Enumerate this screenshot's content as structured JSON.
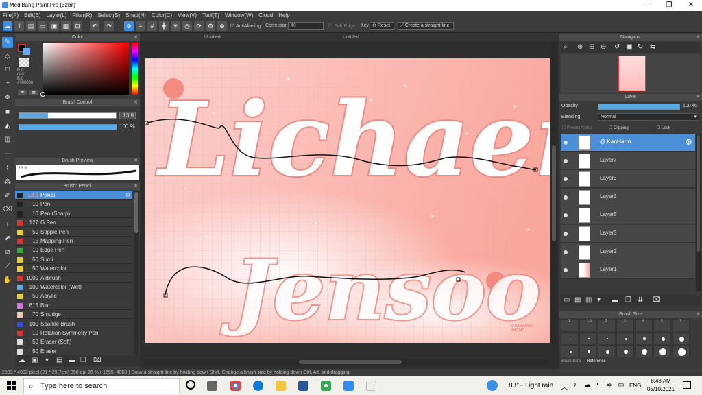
{
  "window": {
    "title": "MediBang Paint Pro (32bit)",
    "minimize": "—",
    "maximize": "❐",
    "close": "✕"
  },
  "menu": [
    "File(F)",
    "Edit(E)",
    "Layer(L)",
    "Filter(R)",
    "Select(S)",
    "Snap(N)",
    "Color(C)",
    "View(V)",
    "Tool(T)",
    "Window(W)",
    "Cloud",
    "Help"
  ],
  "toolbar": {
    "antialiasing": "AntiAliasing",
    "correction_label": "Correction",
    "correction_value": "40",
    "soft_edge": "Soft Edge",
    "key": "Key",
    "reset": "Reset",
    "straight_line": "Create a straight line"
  },
  "color_panel": {
    "title": "Color",
    "rgb": "R:0\nG:0\nB:0",
    "hex": "#000000",
    "primary": "#000000"
  },
  "brush_control": {
    "title": "Brush Control",
    "size": "13.9",
    "opacity": "100 %",
    "size_fraction": 0.3,
    "opacity_fraction": 1.0
  },
  "brush_preview": {
    "title": "Brush Preview",
    "size_label": "13.9"
  },
  "brush_list": {
    "title": "Brush: Pencil",
    "items": [
      {
        "size": "13.9",
        "name": "Pencil",
        "color": "#222222",
        "selected": true
      },
      {
        "size": "10",
        "name": "Pen",
        "color": "#222222"
      },
      {
        "size": "10",
        "name": "Pen (Sharp)",
        "color": "#222222"
      },
      {
        "size": "127",
        "name": "G Pen",
        "color": "#e03030"
      },
      {
        "size": "50",
        "name": "Stipple Pen",
        "color": "#e8d020"
      },
      {
        "size": "15",
        "name": "Mapping Pen",
        "color": "#e03030"
      },
      {
        "size": "10",
        "name": "Edge Pen",
        "color": "#30b030"
      },
      {
        "size": "50",
        "name": "Sumi",
        "color": "#e8d020"
      },
      {
        "size": "50",
        "name": "Watercolor",
        "color": "#e8d020"
      },
      {
        "size": "1000",
        "name": "Airbrush",
        "color": "#e03030"
      },
      {
        "size": "100",
        "name": "Watercolor (Wet)",
        "color": "#5aaae8"
      },
      {
        "size": "50",
        "name": "Acrylic",
        "color": "#e8d020"
      },
      {
        "size": "615",
        "name": "Blur",
        "color": "#e070e0"
      },
      {
        "size": "70",
        "name": "Smudge",
        "color": "#f0c8b0"
      },
      {
        "size": "100",
        "name": "Sparkle Brush",
        "color": "#3050e0"
      },
      {
        "size": "10",
        "name": "Rotation Symmetry Pen",
        "color": "#e03030"
      },
      {
        "size": "50",
        "name": "Eraser (Soft)",
        "color": "#dddddd"
      },
      {
        "size": "50",
        "name": "Eraser",
        "color": "#dddddd"
      }
    ]
  },
  "documents": {
    "tab1": "Untitled",
    "tab2": "Untitled"
  },
  "artwork": {
    "signature": "© KANHARIN\n#HD247"
  },
  "navigator": {
    "title": "Navigator"
  },
  "layer_panel": {
    "title": "Layer",
    "opacity_label": "Opacity",
    "opacity_value": "100 %",
    "opacity_fraction": 1.0,
    "blending_label": "Blending",
    "blending_value": "Normal",
    "protect_alpha": "Protect Alpha",
    "clipping": "Clipping",
    "lock": "Lock",
    "layers": [
      {
        "name": "@ KanHarin",
        "selected": true
      },
      {
        "name": "Layer7"
      },
      {
        "name": "Layer3"
      },
      {
        "name": "Layer3"
      },
      {
        "name": "Layer5"
      },
      {
        "name": "Layer5"
      },
      {
        "name": "Layer2"
      },
      {
        "name": "Layer1"
      }
    ]
  },
  "brush_size_panel": {
    "title": "Brush Size",
    "tabs": [
      "Brush Size",
      "Reference"
    ],
    "sizes": [
      "1",
      "1.5",
      "2",
      "3",
      "4",
      "5",
      "7"
    ]
  },
  "statusbar": "2893 * 4092 pixel  (21 * 29.7cm)  350 dpi  26 %  ( 1655, 4068 )  Draw a straight line by holding down Shift, Change a brush size by holding down Ctrl, Alt, and dragging",
  "taskbar": {
    "search_placeholder": "Type here to search",
    "weather": "83°F  Light rain",
    "lang": "ENG",
    "time": "8:48 AM",
    "date": "05/10/2021"
  }
}
